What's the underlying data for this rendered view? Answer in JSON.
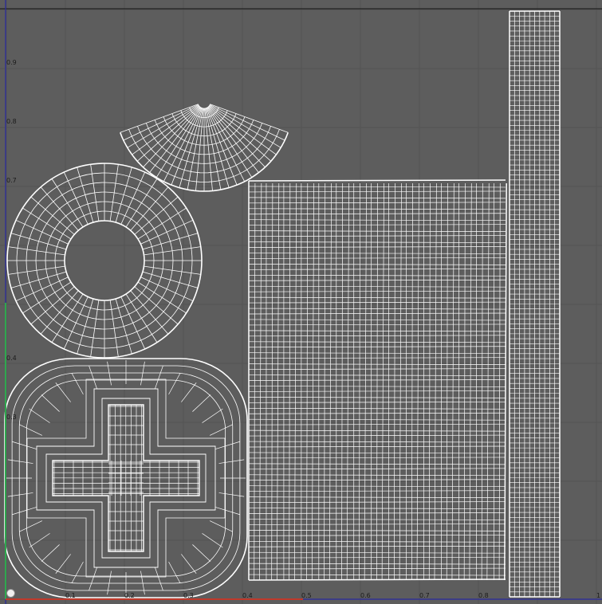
{
  "editor": {
    "view": "UV Texture Editor"
  },
  "axis": {
    "u_ticks": [
      "0.1",
      "0.2",
      "0.3",
      "0.4",
      "0.5",
      "0.6",
      "0.7",
      "0.8"
    ],
    "v_ticks": [
      "0.9",
      "0.8",
      "0.7",
      "0.4",
      "0.3"
    ],
    "u_end": "1"
  },
  "colors": {
    "background": "#5d5d5d",
    "grid": "#535353",
    "uv_wire": "#ffffff",
    "u_axis": "#c0392b",
    "v_axis": "#2fa84f",
    "border": "#2a2aa0"
  },
  "uv_shells": [
    "ring",
    "disk-cross",
    "fan-arc",
    "rectangle-grid",
    "strip"
  ]
}
